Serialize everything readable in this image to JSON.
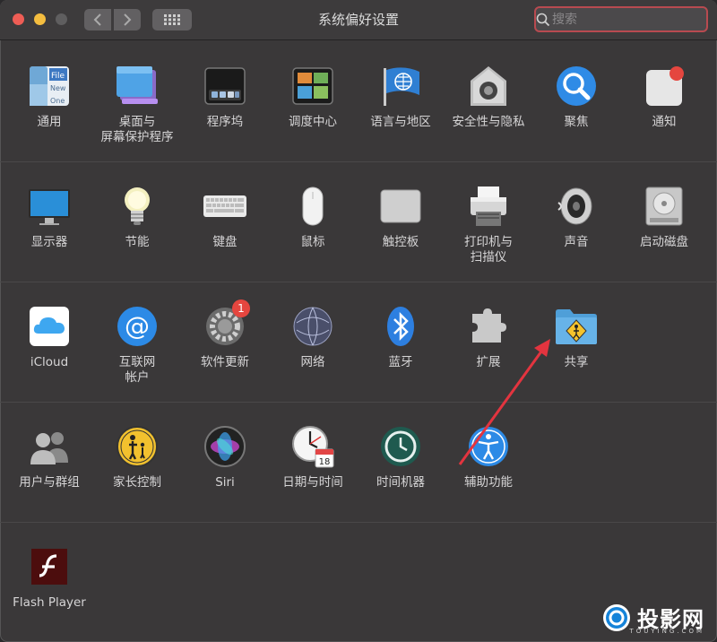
{
  "window": {
    "title": "系统偏好设置"
  },
  "search": {
    "placeholder": "搜索"
  },
  "icons": {
    "back": "chevron-left-icon",
    "forward": "chevron-right-icon",
    "grid": "grid-icon",
    "search": "magnifier-icon"
  },
  "colors": {
    "window_bg": "#3a3839",
    "titlebar_bg": "#3d3b3c",
    "search_border": "#b84a50",
    "arrow": "#e3343f",
    "badge": "#e5463f"
  },
  "rows": [
    {
      "items": [
        {
          "label": "通用",
          "icon": "general-icon"
        },
        {
          "label": "桌面与\n屏幕保护程序",
          "icon": "desktop-screensaver-icon"
        },
        {
          "label": "程序坞",
          "icon": "dock-icon"
        },
        {
          "label": "调度中心",
          "icon": "mission-control-icon"
        },
        {
          "label": "语言与地区",
          "icon": "language-region-icon"
        },
        {
          "label": "安全性与隐私",
          "icon": "security-privacy-icon"
        },
        {
          "label": "聚焦",
          "icon": "spotlight-icon"
        },
        {
          "label": "通知",
          "icon": "notifications-icon"
        }
      ]
    },
    {
      "items": [
        {
          "label": "显示器",
          "icon": "displays-icon"
        },
        {
          "label": "节能",
          "icon": "energy-saver-icon"
        },
        {
          "label": "键盘",
          "icon": "keyboard-icon"
        },
        {
          "label": "鼠标",
          "icon": "mouse-icon"
        },
        {
          "label": "触控板",
          "icon": "trackpad-icon"
        },
        {
          "label": "打印机与\n扫描仪",
          "icon": "printers-scanners-icon"
        },
        {
          "label": "声音",
          "icon": "sound-icon"
        },
        {
          "label": "启动磁盘",
          "icon": "startup-disk-icon"
        }
      ]
    },
    {
      "items": [
        {
          "label": "iCloud",
          "icon": "icloud-icon"
        },
        {
          "label": "互联网\n帐户",
          "icon": "internet-accounts-icon"
        },
        {
          "label": "软件更新",
          "icon": "software-update-icon",
          "badge": "1"
        },
        {
          "label": "网络",
          "icon": "network-icon"
        },
        {
          "label": "蓝牙",
          "icon": "bluetooth-icon"
        },
        {
          "label": "扩展",
          "icon": "extensions-icon"
        },
        {
          "label": "共享",
          "icon": "sharing-icon"
        }
      ]
    },
    {
      "items": [
        {
          "label": "用户与群组",
          "icon": "users-groups-icon"
        },
        {
          "label": "家长控制",
          "icon": "parental-controls-icon"
        },
        {
          "label": "Siri",
          "icon": "siri-icon"
        },
        {
          "label": "日期与时间",
          "icon": "date-time-icon"
        },
        {
          "label": "时间机器",
          "icon": "time-machine-icon"
        },
        {
          "label": "辅助功能",
          "icon": "accessibility-icon"
        }
      ]
    },
    {
      "items": [
        {
          "label": "Flash Player",
          "icon": "flash-player-icon"
        }
      ]
    }
  ],
  "watermark": {
    "text": "投影网",
    "sub": "TOUYING.COM"
  }
}
